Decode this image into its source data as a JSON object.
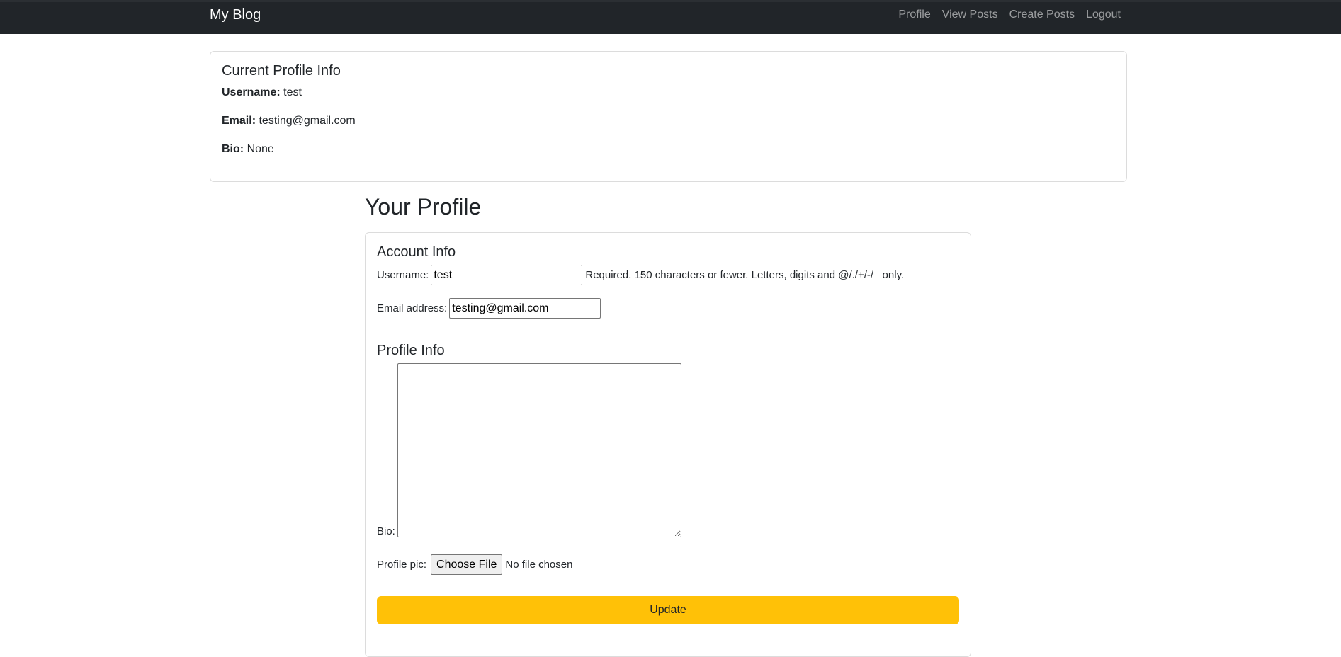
{
  "navbar": {
    "brand": "My Blog",
    "links": [
      "Profile",
      "View Posts",
      "Create Posts",
      "Logout"
    ]
  },
  "current_profile": {
    "title": "Current Profile Info",
    "username_label": "Username:",
    "username": "test",
    "email_label": "Email:",
    "email": "testing@gmail.com",
    "bio_label": "Bio:",
    "bio": "None"
  },
  "page_title": "Your Profile",
  "form": {
    "account_heading": "Account Info",
    "username_label": "Username:",
    "username_value": "test",
    "username_help": "Required. 150 characters or fewer. Letters, digits and @/./+/-/_ only.",
    "email_label": "Email address:",
    "email_value": "testing@gmail.com",
    "profile_heading": "Profile Info",
    "bio_label": "Bio:",
    "bio_value": "",
    "pic_label": "Profile pic:",
    "choose_file": "Choose File",
    "no_file": "No file chosen",
    "submit": "Update"
  },
  "colors": {
    "navbar": "#212529",
    "update_button": "#ffc107"
  }
}
